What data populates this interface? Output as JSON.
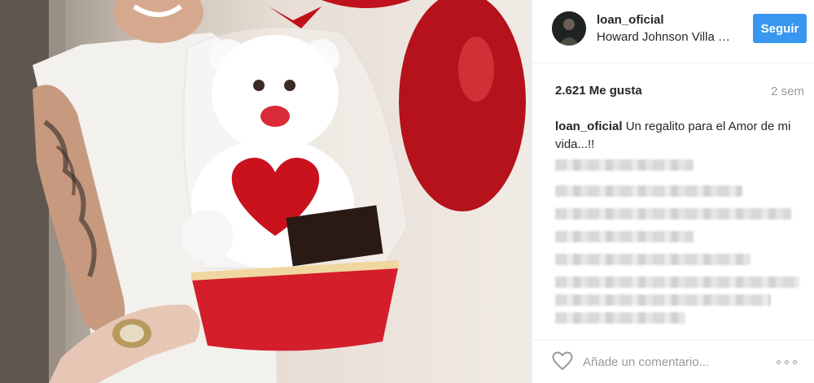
{
  "post": {
    "photo": {
      "alt": "Oso de peluche con corazón en canasta de regalo"
    },
    "header": {
      "username": "loan_oficial",
      "location": "Howard Johnson Villa Gesell",
      "follow_label": "Seguir",
      "avatar_icon": "profile-avatar"
    },
    "likes": "2.621 Me gusta",
    "time": "2 sem",
    "caption": {
      "username": "loan_oficial",
      "text": "Un regalito para el Amor de mi vida...!!"
    },
    "footer": {
      "like_icon": "heart-outline-icon",
      "comment_placeholder": "Añade un comentario...",
      "more_icon": "ellipsis-icon"
    }
  },
  "colors": {
    "follow_button": "#3897f0",
    "text": "#262626",
    "muted": "#999999",
    "border": "#efefef"
  }
}
